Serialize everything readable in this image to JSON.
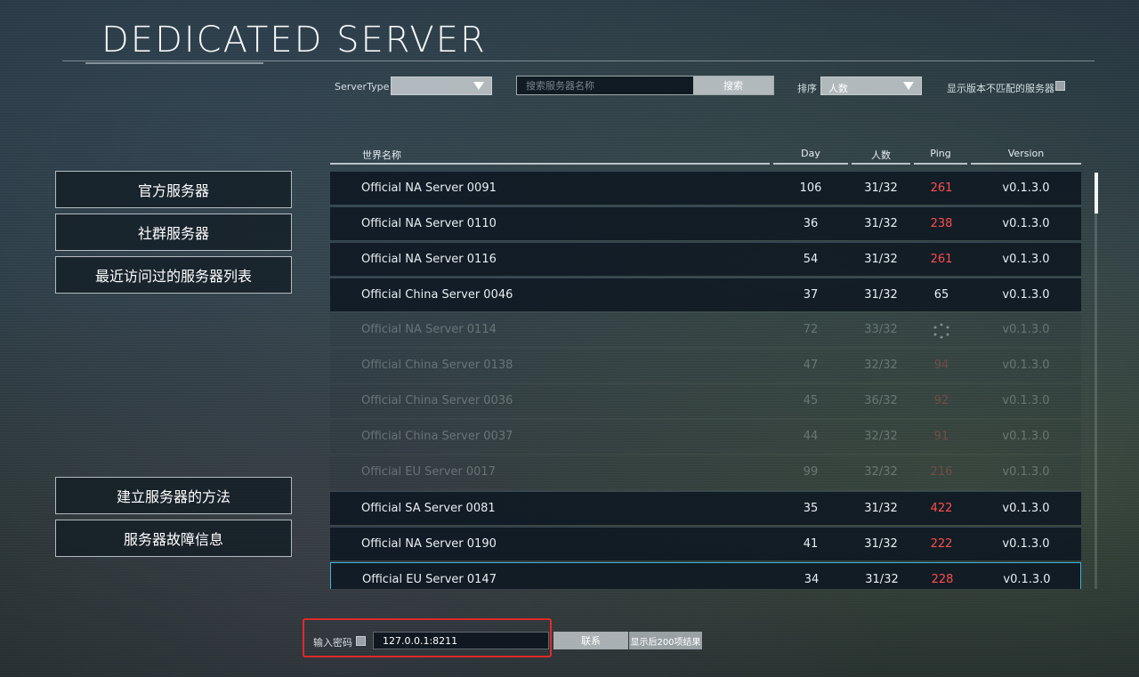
{
  "title": "DEDICATED SERVER",
  "filters": {
    "server_type_label": "ServerType",
    "server_type_value": "",
    "search_placeholder": "搜索服务器名称",
    "search_button": "搜索",
    "sort_label": "排序",
    "sort_value": "人数",
    "show_mismatch_label": "显示版本不匹配的服务器"
  },
  "sidebar": {
    "items": [
      {
        "label": "官方服务器"
      },
      {
        "label": "社群服务器"
      },
      {
        "label": "最近访问过的服务器列表"
      },
      {
        "label": "建立服务器的方法"
      },
      {
        "label": "服务器故障信息"
      }
    ]
  },
  "table": {
    "columns": [
      "世界名称",
      "Day",
      "人数",
      "Ping",
      "Version"
    ],
    "rows": [
      {
        "name": "Official NA Server 0091",
        "day": "106",
        "players": "31/32",
        "ping": "261",
        "version": "v0.1.3.0"
      },
      {
        "name": "Official NA Server 0110",
        "day": "36",
        "players": "31/32",
        "ping": "238",
        "version": "v0.1.3.0"
      },
      {
        "name": "Official NA Server 0116",
        "day": "54",
        "players": "31/32",
        "ping": "261",
        "version": "v0.1.3.0"
      },
      {
        "name": "Official China Server 0046",
        "day": "37",
        "players": "31/32",
        "ping": "65",
        "version": "v0.1.3.0"
      },
      {
        "name": "Official NA Server 0114",
        "day": "72",
        "players": "33/32",
        "ping": "",
        "version": "v0.1.3.0"
      },
      {
        "name": "Official China Server 0138",
        "day": "47",
        "players": "32/32",
        "ping": "94",
        "version": "v0.1.3.0"
      },
      {
        "name": "Official China Server 0036",
        "day": "45",
        "players": "36/32",
        "ping": "92",
        "version": "v0.1.3.0"
      },
      {
        "name": "Official China Server 0037",
        "day": "44",
        "players": "32/32",
        "ping": "91",
        "version": "v0.1.3.0"
      },
      {
        "name": "Official EU Server 0017",
        "day": "99",
        "players": "32/32",
        "ping": "216",
        "version": "v0.1.3.0"
      },
      {
        "name": "Official SA Server 0081",
        "day": "35",
        "players": "31/32",
        "ping": "422",
        "version": "v0.1.3.0"
      },
      {
        "name": "Official NA Server 0190",
        "day": "41",
        "players": "31/32",
        "ping": "222",
        "version": "v0.1.3.0"
      },
      {
        "name": "Official EU Server 0147",
        "day": "34",
        "players": "31/32",
        "ping": "228",
        "version": "v0.1.3.0"
      }
    ]
  },
  "bottom": {
    "password_label": "输入密码",
    "address_value": "127.0.0.1:8211",
    "connect_button": "联系",
    "more_button": "显示后200项结果"
  },
  "colors": {
    "ping_high": "#ff4c4c",
    "selected_border": "#3fb4d6",
    "highlight": "#e02a2a"
  }
}
